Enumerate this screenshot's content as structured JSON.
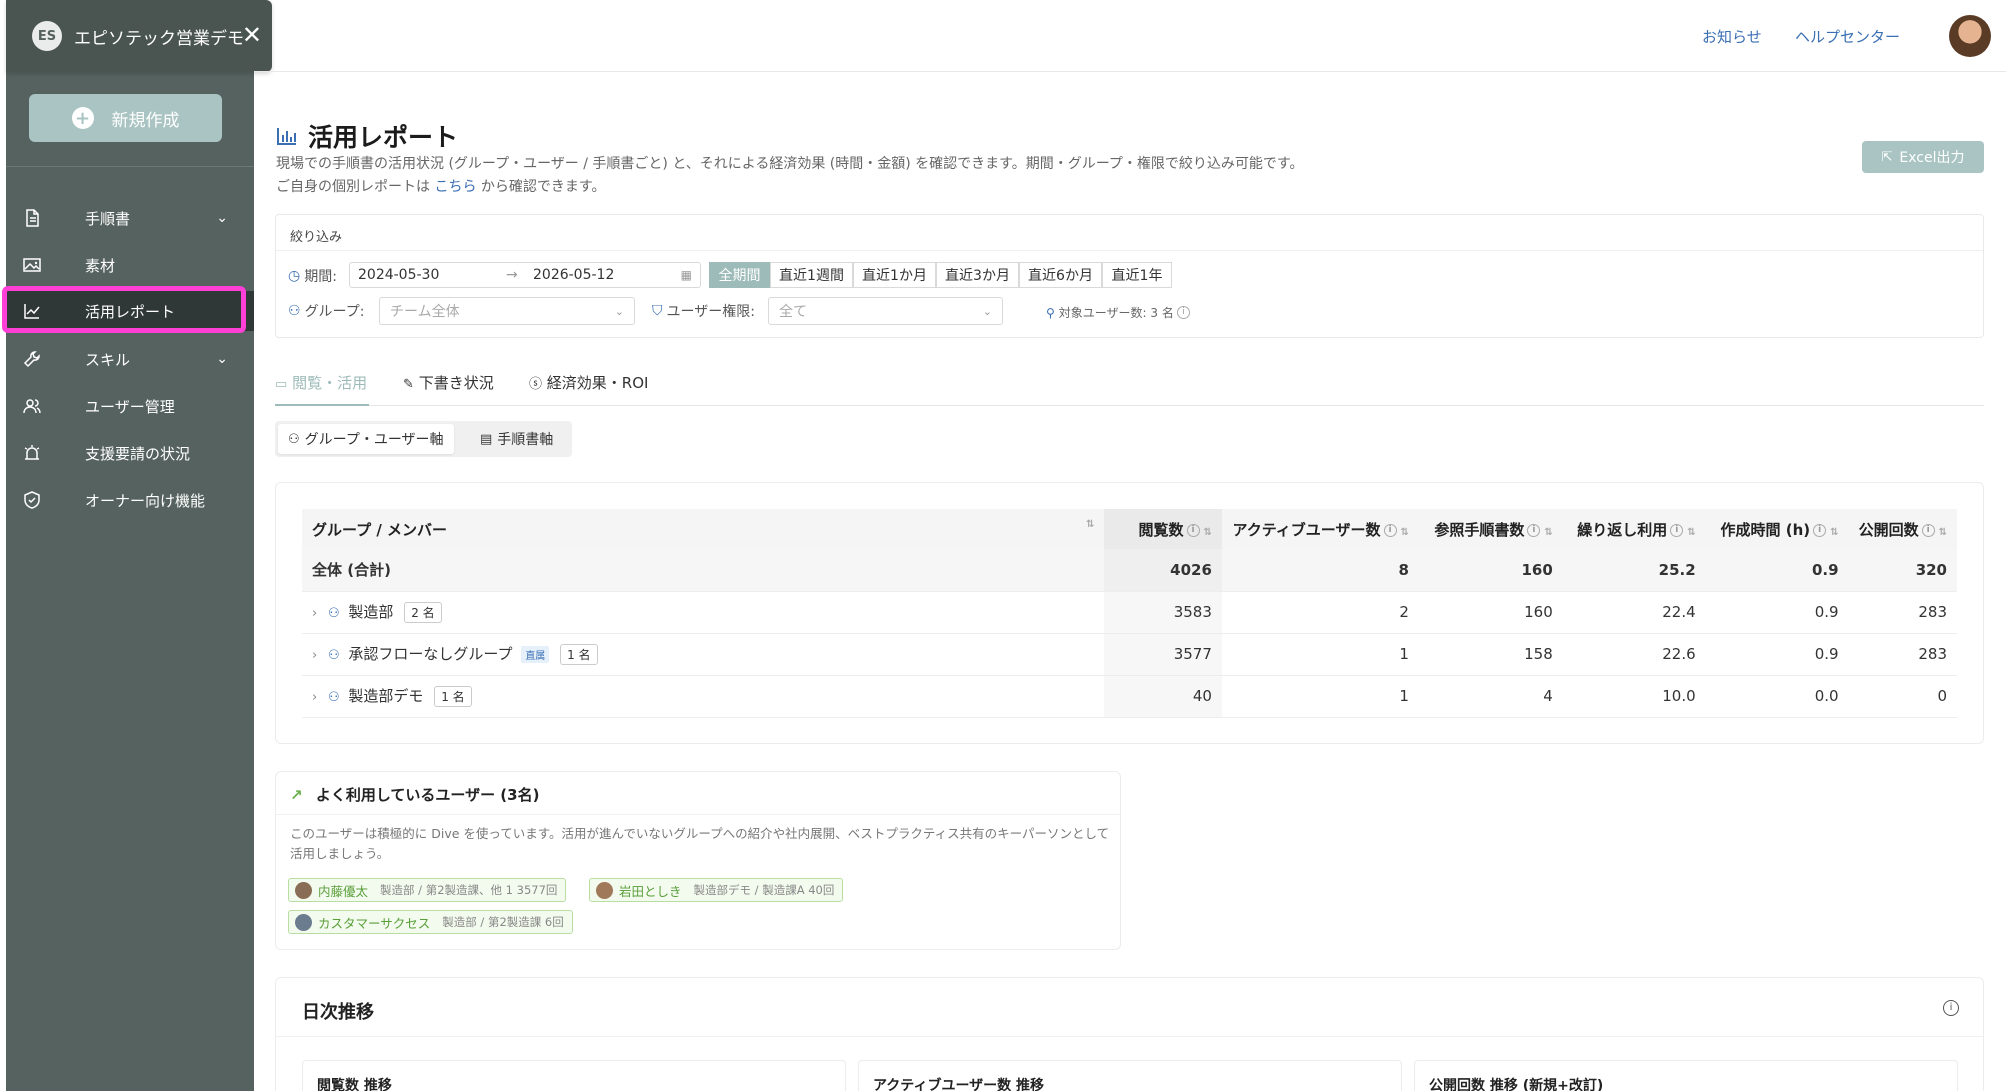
{
  "brand": {
    "name": "エピソテック営業デモ",
    "logo_text": "ES"
  },
  "sidebar": {
    "new_button": "新規作成",
    "items": [
      {
        "label": "手順書",
        "icon": "document-icon",
        "has_children": true
      },
      {
        "label": "素材",
        "icon": "image-icon",
        "has_children": false
      },
      {
        "label": "活用レポート",
        "icon": "chart-line-icon",
        "has_children": false,
        "active": true
      },
      {
        "label": "スキル",
        "icon": "wrench-icon",
        "has_children": true
      },
      {
        "label": "ユーザー管理",
        "icon": "users-icon",
        "has_children": false
      },
      {
        "label": "支援要請の状況",
        "icon": "alarm-icon",
        "has_children": false
      },
      {
        "label": "オーナー向け機能",
        "icon": "shield-icon",
        "has_children": false
      }
    ]
  },
  "header": {
    "news": "お知らせ",
    "help": "ヘルプセンター"
  },
  "page": {
    "title": "活用レポート",
    "desc1": "現場での手順書の活用状況 (グループ・ユーザー / 手順書ごと) と、それによる経済効果 (時間・金額) を確認できます。期間・グループ・権限で絞り込み可能です。",
    "desc2_prefix": "ご自身の個別レポートは",
    "desc2_link": "こちら",
    "desc2_suffix": "から確認できます。",
    "excel_button": "Excel出力"
  },
  "filter": {
    "heading": "絞り込み",
    "period_label": "期間:",
    "date_from": "2024-05-30",
    "date_to": "2026-05-12",
    "periods": [
      "全期間",
      "直近1週間",
      "直近1か月",
      "直近3か月",
      "直近6か月",
      "直近1年"
    ],
    "group_label": "グループ:",
    "group_placeholder": "チーム全体",
    "role_label": "ユーザー権限:",
    "role_placeholder": "全て",
    "target_users": "対象ユーザー数: 3 名"
  },
  "tabs": [
    "閲覧・活用",
    "下書き状況",
    "経済効果・ROI"
  ],
  "segments": [
    "グループ・ユーザー軸",
    "手順書軸"
  ],
  "table": {
    "headers": [
      "グループ / メンバー",
      "閲覧数",
      "アクティブユーザー数",
      "参照手順書数",
      "繰り返し利用",
      "作成時間 (h)",
      "公開回数"
    ],
    "total": {
      "name": "全体 (合計)",
      "views": "4026",
      "active": "8",
      "docs": "160",
      "repeat": "25.2",
      "hours": "0.9",
      "published": "320"
    },
    "rows": [
      {
        "name": "製造部",
        "badge": "",
        "count": "2 名",
        "views": "3583",
        "active": "2",
        "docs": "160",
        "repeat": "22.4",
        "hours": "0.9",
        "published": "283"
      },
      {
        "name": "承認フローなしグループ",
        "badge": "直属",
        "count": "1 名",
        "views": "3577",
        "active": "1",
        "docs": "158",
        "repeat": "22.6",
        "hours": "0.9",
        "published": "283"
      },
      {
        "name": "製造部デモ",
        "badge": "",
        "count": "1 名",
        "views": "40",
        "active": "1",
        "docs": "4",
        "repeat": "10.0",
        "hours": "0.0",
        "published": "0"
      }
    ]
  },
  "frequent_users": {
    "title": "よく利用しているユーザー (3名)",
    "desc": "このユーザーは積極的に Dive を使っています。活用が進んでいないグループへの紹介や社内展開、ベストプラクティス共有のキーパーソンとして活用しましょう。",
    "users": [
      {
        "name": "内藤優太",
        "meta": "製造部 / 第2製造課、他 1  3577回"
      },
      {
        "name": "岩田としき",
        "meta": "製造部デモ / 製造課A  40回"
      },
      {
        "name": "カスタマーサクセス",
        "meta": "製造部 / 第2製造課  6回"
      }
    ]
  },
  "daily": {
    "title": "日次推移",
    "cards": [
      "閲覧数 推移",
      "アクティブユーザー数 推移",
      "公開回数 推移 (新規+改訂)"
    ]
  },
  "colors": {
    "sidebar": "#56625f",
    "accent": "#9dbbb8",
    "highlight": "#ff3fd6",
    "positive": "#6ab04c",
    "link": "#3a6fb3"
  }
}
